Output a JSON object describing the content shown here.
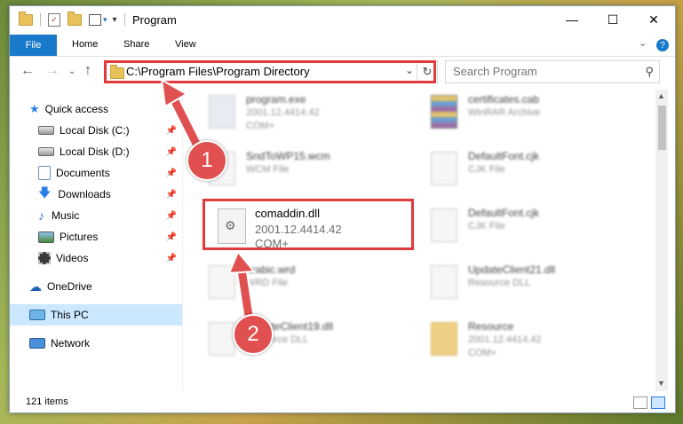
{
  "window": {
    "title": "Program",
    "minimize_glyph": "—",
    "maximize_glyph": "☐",
    "close_glyph": "✕"
  },
  "ribbon": {
    "tabs": [
      "File",
      "Home",
      "Share",
      "View"
    ],
    "expand_glyph": "⌄",
    "help_glyph": "?"
  },
  "address": {
    "path": "C:\\Program Files\\Program Directory",
    "dropdown_glyph": "⌄",
    "refresh_glyph": "↻"
  },
  "nav": {
    "back_glyph": "←",
    "forward_glyph": "→",
    "recent_glyph": "⌄",
    "up_glyph": "↑"
  },
  "search": {
    "placeholder": "Search Program",
    "icon_glyph": "⚲"
  },
  "sidebar": {
    "pin_glyph": "📌",
    "items": [
      {
        "label": "Quick access",
        "icon": "star-icon"
      },
      {
        "label": "Local Disk (C:)",
        "icon": "drive-icon"
      },
      {
        "label": "Local Disk (D:)",
        "icon": "drive-icon"
      },
      {
        "label": "Documents",
        "icon": "documents-icon"
      },
      {
        "label": "Downloads",
        "icon": "download-icon"
      },
      {
        "label": "Music",
        "icon": "music-icon"
      },
      {
        "label": "Pictures",
        "icon": "pictures-icon"
      },
      {
        "label": "Videos",
        "icon": "videos-icon"
      },
      {
        "label": "OneDrive",
        "icon": "cloud-icon"
      },
      {
        "label": "This PC",
        "icon": "computer-icon"
      },
      {
        "label": "Network",
        "icon": "network-icon"
      }
    ]
  },
  "files": [
    {
      "name": "program.exe",
      "line1": "2001.12.4414.42",
      "line2": "COM+"
    },
    {
      "name": "certificates.cab",
      "line1": "WinRAR Archive",
      "line2": ""
    },
    {
      "name": "SndToWP15.wcm",
      "line1": "WCM File",
      "line2": ""
    },
    {
      "name": "DefaultFont.cjk",
      "line1": "CJK File",
      "line2": ""
    },
    {
      "name": "comaddin.dll",
      "line1": "2001.12.4414.42",
      "line2": "COM+"
    },
    {
      "name": "DefaultFont.cjk",
      "line1": "CJK File",
      "line2": ""
    },
    {
      "name": "arabic.wrd",
      "line1": "WRD File",
      "line2": ""
    },
    {
      "name": "UpdateClient21.dll",
      "line1": "Resource DLL",
      "line2": ""
    },
    {
      "name": "UpdateClient19.dll",
      "line1": "Resource DLL",
      "line2": ""
    },
    {
      "name": "Resource",
      "line1": "2001.12.4414.42",
      "line2": "COM+"
    }
  ],
  "status": {
    "item_count": "121 items"
  },
  "annotations": {
    "step1": "1",
    "step2": "2"
  },
  "colors": {
    "highlight": "#e03a3a",
    "badge": "#e05050",
    "file_tab": "#1979ca",
    "selected": "#cce8ff"
  }
}
